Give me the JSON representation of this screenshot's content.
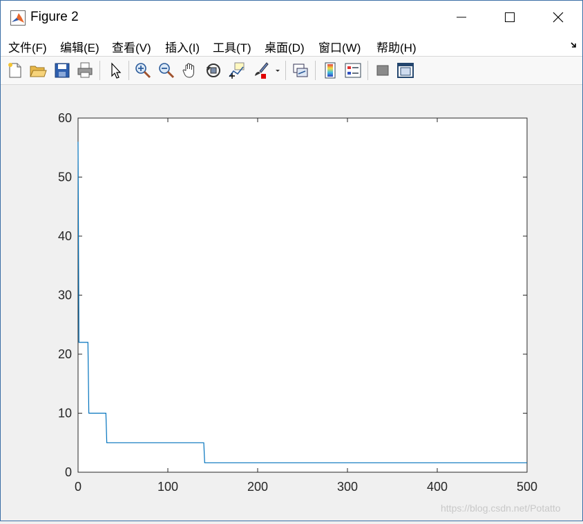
{
  "window": {
    "title": "Figure 2"
  },
  "menu": [
    {
      "label": "文件(F)"
    },
    {
      "label": "编辑(E)"
    },
    {
      "label": "查看(V)"
    },
    {
      "label": "插入(I)"
    },
    {
      "label": "工具(T)"
    },
    {
      "label": "桌面(D)"
    },
    {
      "label": "窗口(W)"
    },
    {
      "label": "帮助(H)"
    }
  ],
  "toolbar": {
    "icons": [
      "new-figure-icon",
      "open-file-icon",
      "save-icon",
      "print-icon",
      "edit-plot-arrow-icon",
      "zoom-in-icon",
      "zoom-out-icon",
      "pan-hand-icon",
      "rotate-3d-icon",
      "data-cursor-icon",
      "brush-icon",
      "brush-dropdown-icon",
      "link-plot-icon",
      "colorbar-icon",
      "legend-icon",
      "hide-plot-tools-icon",
      "show-plot-tools-icon"
    ]
  },
  "chart_data": {
    "type": "line",
    "title": "",
    "xlabel": "",
    "ylabel": "",
    "xlim": [
      0,
      500
    ],
    "ylim": [
      0,
      60
    ],
    "xticks": [
      "0",
      "100",
      "200",
      "300",
      "400",
      "500"
    ],
    "yticks": [
      "0",
      "10",
      "20",
      "30",
      "40",
      "50",
      "60"
    ],
    "grid": false,
    "series": [
      {
        "color": "#0072bd",
        "x": [
          0,
          1,
          2,
          11,
          12,
          31,
          32,
          140,
          141,
          500
        ],
        "y": [
          56,
          22,
          22,
          22,
          10,
          10,
          5,
          5,
          1.6,
          1.6
        ]
      }
    ]
  },
  "watermark": "https://blog.csdn.net/Potatto",
  "colors": {
    "line": "#0072bd",
    "figure_bg": "#f0f0f0",
    "axes_bg": "#ffffff"
  }
}
